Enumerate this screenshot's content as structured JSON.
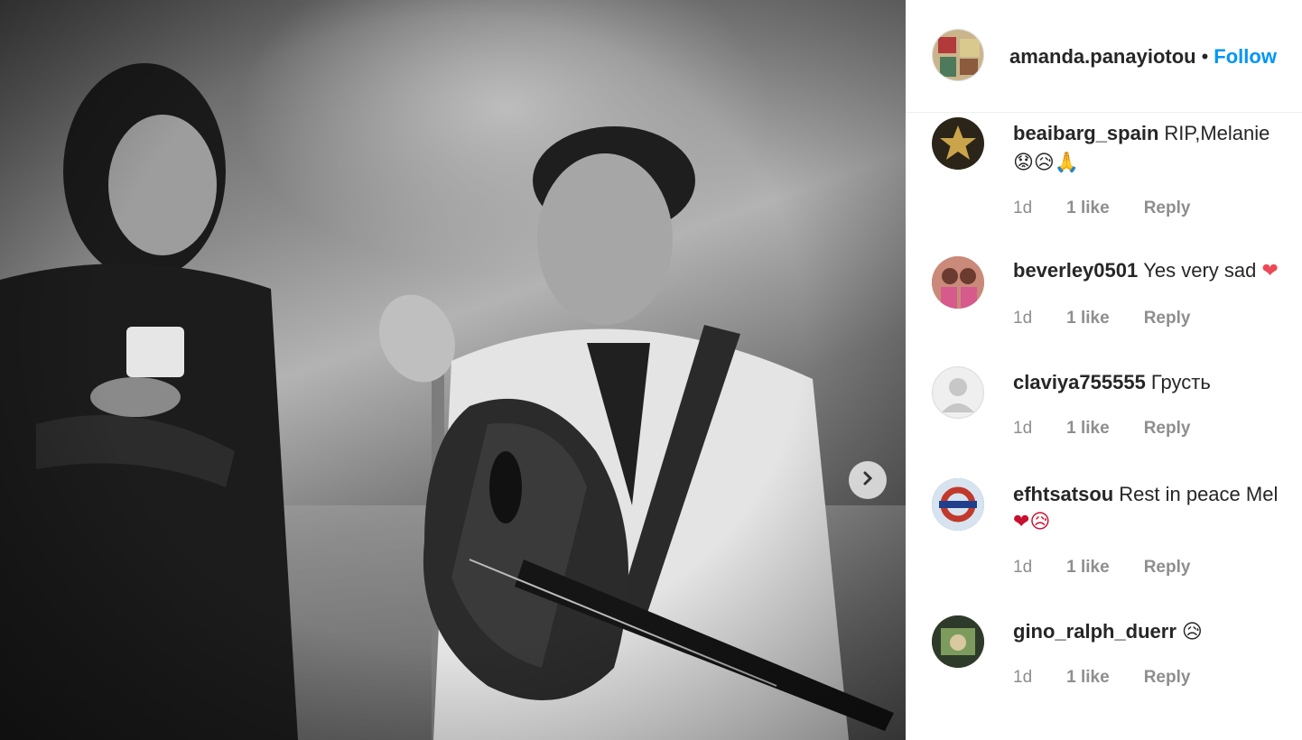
{
  "post": {
    "username": "amanda.panayiotou",
    "separator": "•",
    "follow_label": "Follow",
    "next_icon": "chevron-right-icon"
  },
  "comments": [
    {
      "user": "beaibarg_spain",
      "text": "RIP,Melanie",
      "line2": "😟😥🙏",
      "time": "1d",
      "likes": "1 like",
      "reply": "Reply",
      "avatar_color": "#2b2418",
      "avatar_icon": "star-icon"
    },
    {
      "user": "beverley0501",
      "text": "Yes very sad",
      "trail": "❤",
      "time": "1d",
      "likes": "1 like",
      "reply": "Reply",
      "avatar_color": "#c98a7a"
    },
    {
      "user": "claviya755555",
      "text": "Грусть",
      "time": "1d",
      "likes": "1 like",
      "reply": "Reply",
      "avatar_color": "#dbdbdb",
      "avatar_icon": "default-user-icon"
    },
    {
      "user": "efhtsatsou",
      "text": "Rest in peace Mel",
      "line2": "❤😥",
      "time": "1d",
      "likes": "1 like",
      "reply": "Reply",
      "avatar_color": "#3a6ea5"
    },
    {
      "user": "gino_ralph_duerr",
      "text": "😥",
      "time": "1d",
      "likes": "1 like",
      "reply": "Reply",
      "avatar_color": "#4f6b3c"
    }
  ],
  "colors": {
    "accent": "#0095f6",
    "meta": "#8e8e8e",
    "heart": "#ed4956"
  }
}
